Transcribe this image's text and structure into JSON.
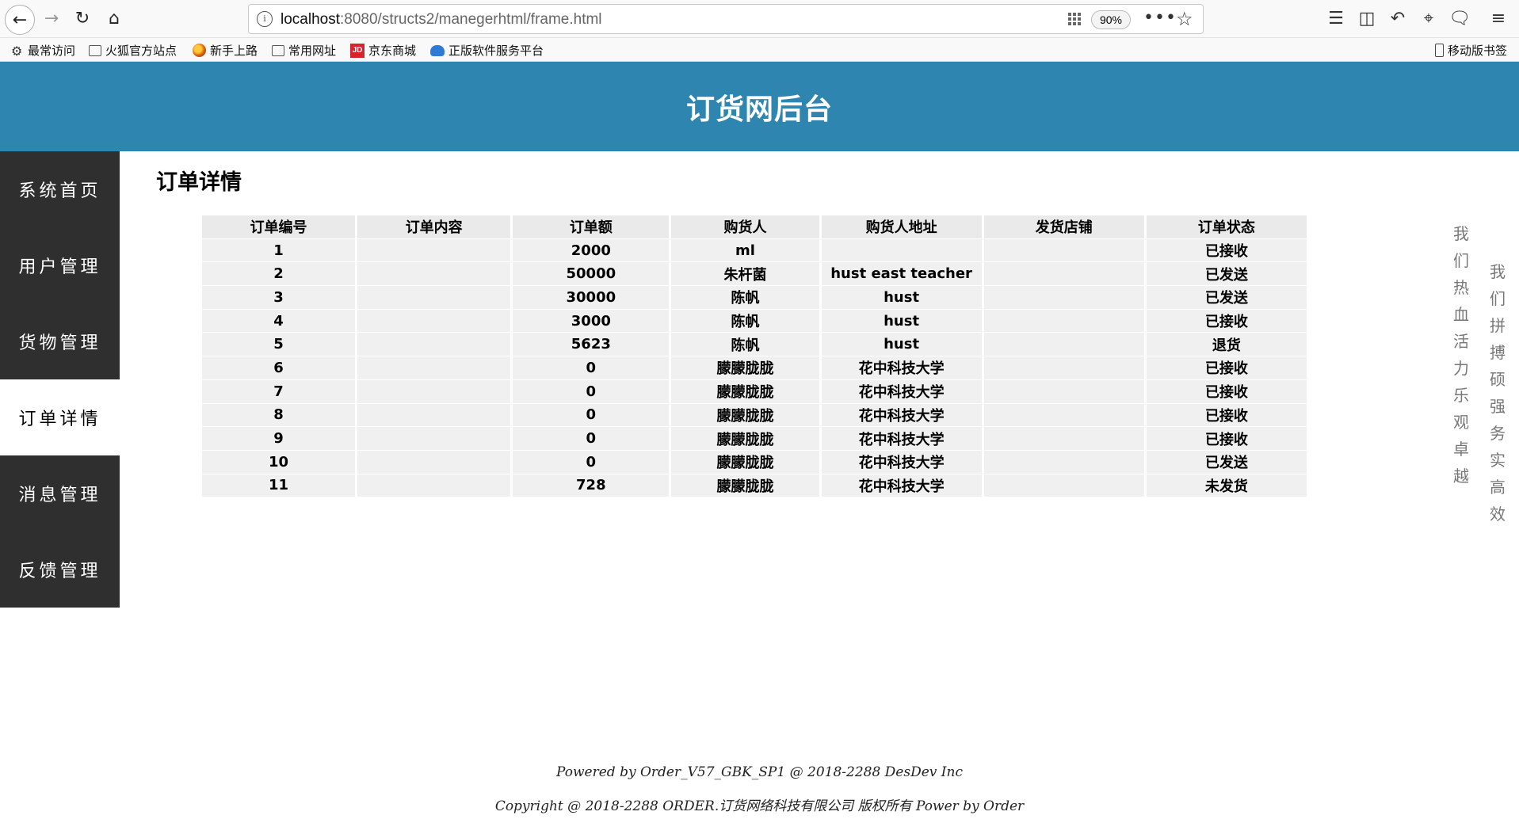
{
  "browser": {
    "url_host": "localhost",
    "url_rest": ":8080/structs2/manegerhtml/frame.html",
    "zoom": "90%",
    "bookmarks": [
      "最常访问",
      "火狐官方站点",
      "新手上路",
      "常用网址",
      "京东商城",
      "正版软件服务平台"
    ],
    "mobile_bookmarks": "移动版书签",
    "jd_mark": "JD"
  },
  "header": {
    "title": "订货网后台"
  },
  "sidebar": {
    "items": [
      {
        "label": "系统首页"
      },
      {
        "label": "用户管理"
      },
      {
        "label": "货物管理"
      },
      {
        "label": "订单详情"
      },
      {
        "label": "消息管理"
      },
      {
        "label": "反馈管理"
      }
    ],
    "active": "订单详情"
  },
  "main": {
    "title": "订单详情",
    "columns": [
      "订单编号",
      "订单内容",
      "订单额",
      "购货人",
      "购货人地址",
      "发货店铺",
      "订单状态"
    ],
    "rows": [
      [
        "1",
        "",
        "2000",
        "ml",
        "",
        "",
        "已接收"
      ],
      [
        "2",
        "",
        "50000",
        "朱杆菌",
        "hust east teacher",
        "",
        "已发送"
      ],
      [
        "3",
        "",
        "30000",
        "陈帆",
        "hust",
        "",
        "已发送"
      ],
      [
        "4",
        "",
        "3000",
        "陈帆",
        "hust",
        "",
        "已接收"
      ],
      [
        "5",
        "",
        "5623",
        "陈帆",
        "hust",
        "",
        "退货"
      ],
      [
        "6",
        "",
        "0",
        "朦朦胧胧",
        "花中科技大学",
        "",
        "已接收"
      ],
      [
        "7",
        "",
        "0",
        "朦朦胧胧",
        "花中科技大学",
        "",
        "已接收"
      ],
      [
        "8",
        "",
        "0",
        "朦朦胧胧",
        "花中科技大学",
        "",
        "已接收"
      ],
      [
        "9",
        "",
        "0",
        "朦朦胧胧",
        "花中科技大学",
        "",
        "已接收"
      ],
      [
        "10",
        "",
        "0",
        "朦朦胧胧",
        "花中科技大学",
        "",
        "已发送"
      ],
      [
        "11",
        "",
        "728",
        "朦朦胧胧",
        "花中科技大学",
        "",
        "未发货"
      ]
    ]
  },
  "slogans": {
    "left": "我们热血活力乐观卓越",
    "right": "我们拼搏硕强务实高效"
  },
  "footer": {
    "line1": "Powered by Order_V57_GBK_SP1 @ 2018-2288 DesDev Inc",
    "line2": "Copyright @ 2018-2288 ORDER.订货网络科技有限公司 版权所有 Power by Order"
  }
}
